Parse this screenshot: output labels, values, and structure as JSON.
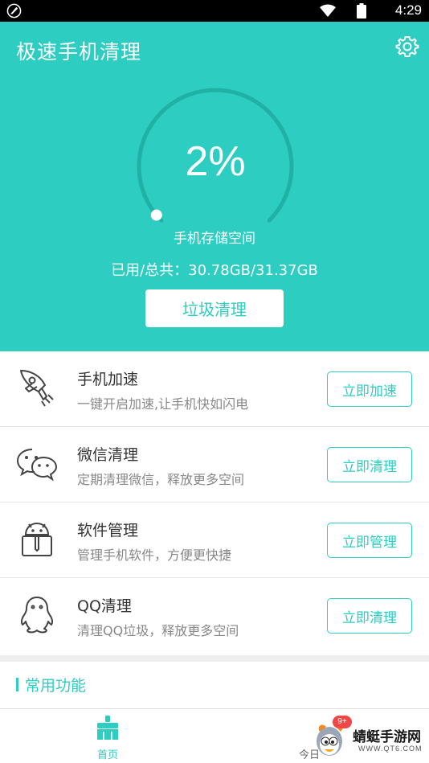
{
  "status_bar": {
    "time": "4:29",
    "icons": [
      "rocket-notification-icon",
      "wifi-icon",
      "battery-icon"
    ]
  },
  "header": {
    "title": "极速手机清理",
    "settings_icon": "gear-icon",
    "storage_percent": "2%",
    "storage_fraction": 0.02,
    "storage_label": "手机存储空间",
    "storage_usage": "已用/总共：30.78GB/31.37GB",
    "clean_button": "垃圾清理"
  },
  "features": [
    {
      "icon": "rocket-icon",
      "title": "手机加速",
      "desc": "一键开启加速,让手机快如闪电",
      "button": "立即加速"
    },
    {
      "icon": "wechat-icon",
      "title": "微信清理",
      "desc": "定期清理微信，释放更多空间",
      "button": "立即清理"
    },
    {
      "icon": "android-box-icon",
      "title": "软件管理",
      "desc": "管理手机软件，方便更快捷",
      "button": "立即管理"
    },
    {
      "icon": "qq-penguin-icon",
      "title": "QQ清理",
      "desc": "清理QQ垃圾，释放更多空间",
      "button": "立即清理"
    }
  ],
  "section": {
    "title": "常用功能"
  },
  "bottom_nav": {
    "home_label": "首页",
    "second_label": "今日"
  },
  "watermark": {
    "badge": "9+",
    "name": "蜻蜓手游网",
    "url": "WWW.QT6.COM"
  },
  "colors": {
    "accent": "#2dcdc2",
    "ring_track": "#1fb0a6",
    "text_primary": "#333333",
    "text_secondary": "#888888",
    "badge": "#f14646"
  }
}
